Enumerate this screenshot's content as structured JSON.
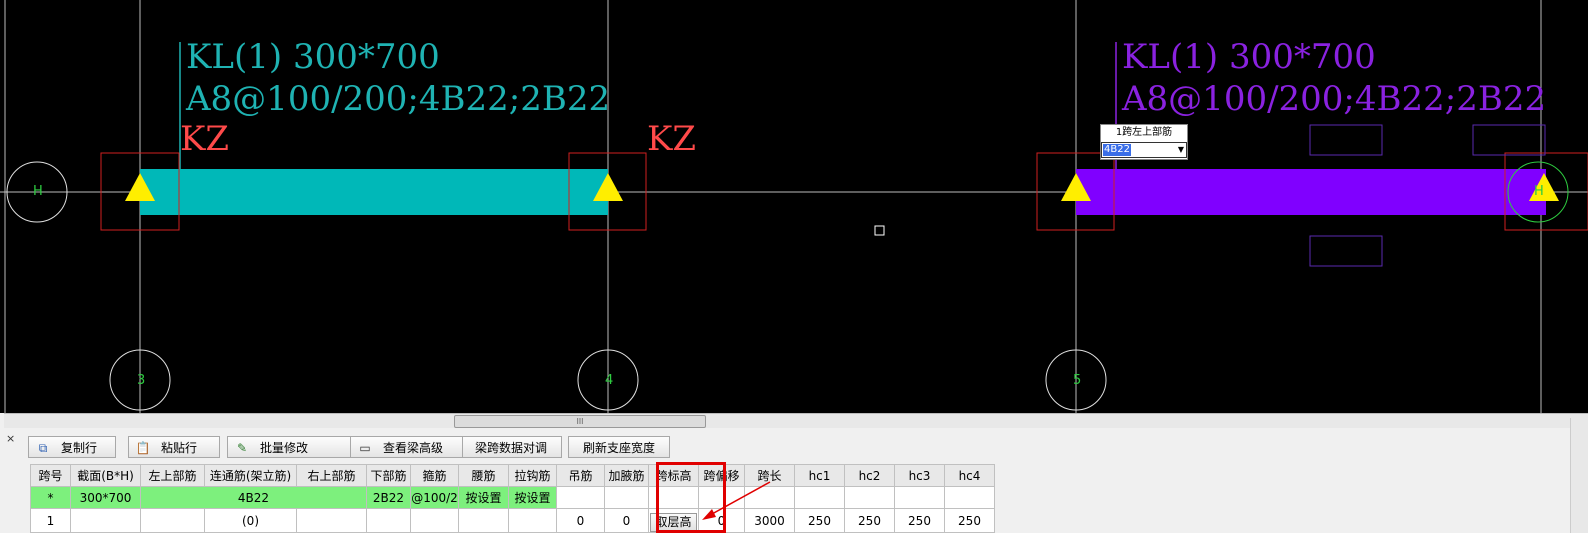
{
  "canvas": {
    "beam_left": {
      "name_line": "KL(1)  300*700",
      "rebar_line": "A8@100/200;4B22;2B22",
      "color": "#1fb3b3"
    },
    "beam_right": {
      "name_line": "KL(1)  300*700",
      "rebar_line": "A8@100/200;4B22;2B22",
      "color": "#8a22e0"
    },
    "column_labels": [
      "KZ",
      "KZ"
    ],
    "axis_labels": [
      "H",
      "3",
      "4",
      "5",
      "H"
    ],
    "popup": {
      "title": "1跨左上部筋",
      "value": "4B22"
    }
  },
  "scrollbar": {
    "thumb_glyph": "lll"
  },
  "toolbar": {
    "close": "×",
    "buttons": [
      {
        "label": "复制行",
        "icon": "copy-icon"
      },
      {
        "label": "粘贴行",
        "icon": "paste-icon"
      },
      {
        "label": "批量修改",
        "icon": "batch-edit-icon"
      },
      {
        "label": "查看梁高级",
        "icon": "view-icon"
      },
      {
        "label": "梁跨数据对调",
        "icon": ""
      },
      {
        "label": "刷新支座宽度",
        "icon": ""
      }
    ]
  },
  "grid": {
    "headers": [
      "跨号",
      "截面(B*H)",
      "左上部筋",
      "连通筋(架立筋)",
      "右上部筋",
      "下部筋",
      "箍筋",
      "腰筋",
      "拉钩筋",
      "吊筋",
      "加腋筋",
      "跨标高",
      "跨偏移",
      "跨长",
      "hc1",
      "hc2",
      "hc3",
      "hc4"
    ],
    "common_row": [
      "*",
      "300*700",
      "",
      "4B22",
      "",
      "2B22",
      "@100/2",
      "按设置",
      "按设置",
      "",
      "",
      "",
      "",
      "",
      "",
      "",
      "",
      ""
    ],
    "row1": [
      "1",
      "",
      "",
      "(0)",
      "",
      "",
      "",
      "",
      "",
      "0",
      "0",
      "取层高",
      "0",
      "3000",
      "250",
      "250",
      "250",
      "250"
    ]
  }
}
